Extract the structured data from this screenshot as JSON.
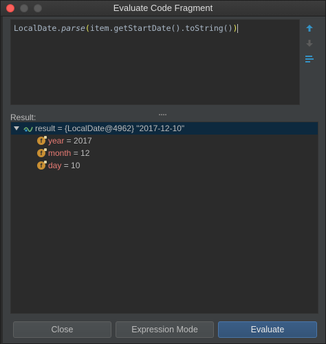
{
  "window": {
    "title": "Evaluate Code Fragment"
  },
  "editor": {
    "code_prefix": "LocalDate.",
    "code_method": "parse",
    "code_open_paren": "(",
    "code_middle": "item.getStartDate().toString()",
    "code_close_paren": ")"
  },
  "side_tools": [
    {
      "icon": "arrow-up-icon",
      "color": "#3592c4"
    },
    {
      "icon": "arrow-down-icon",
      "color": "#5c5c5c"
    },
    {
      "icon": "history-list-icon",
      "color": "#3592c4"
    }
  ],
  "result": {
    "label": "Result:",
    "root": {
      "icon": "watch-result-icon",
      "text": "result = {LocalDate@4962} \"2017-12-10\""
    },
    "fields": [
      {
        "icon": "field-icon",
        "name": "year",
        "value": "2017"
      },
      {
        "icon": "field-icon",
        "name": "month",
        "value": "12"
      },
      {
        "icon": "field-icon",
        "name": "day",
        "value": "10"
      }
    ]
  },
  "buttons": {
    "close": "Close",
    "expression_mode": "Expression Mode",
    "evaluate": "Evaluate"
  },
  "colors": {
    "background": "#3c3f41",
    "editor_bg": "#2b2b2b",
    "selection": "#0d293e",
    "field_name": "#e67a73",
    "field_icon": "#c98f33",
    "primary_button": "#3b5e87"
  }
}
